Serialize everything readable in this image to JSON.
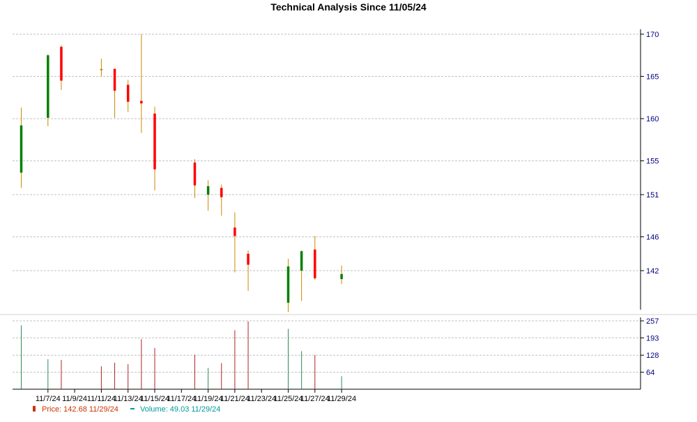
{
  "chart_data": {
    "type": "candlestick",
    "title": "Technical Analysis Since 11/05/24",
    "colors": {
      "up": "#008000",
      "down": "#ff0000",
      "doji": "#cc8800",
      "wick": "#cc8800",
      "volume_up": "#2e8b57",
      "volume_down": "#b22222",
      "price_axis_text": "#000080",
      "date_axis_text": "#000000",
      "grid": "#c0c0c0",
      "legend_price": "#cc3300",
      "legend_volume": "#009999"
    },
    "price_axis": {
      "side": "right",
      "ticks": [
        142,
        146,
        151,
        155,
        160,
        165,
        170
      ],
      "ylim": [
        136.5,
        170.1
      ]
    },
    "volume_axis": {
      "side": "right",
      "ticks": [
        64,
        128,
        193,
        257
      ],
      "ylim": [
        0,
        257
      ]
    },
    "x_ticks": [
      "11/7/24",
      "11/9/24",
      "11/11/24",
      "11/13/24",
      "11/15/24",
      "11/17/24",
      "11/19/24",
      "11/21/24",
      "11/23/24",
      "11/25/24",
      "11/27/24",
      "11/29/24"
    ],
    "grid": true,
    "candles": [
      {
        "date": "11/5/24",
        "open": 153.6,
        "high": 161.3,
        "low": 151.8,
        "close": 159.2,
        "volume": 240
      },
      {
        "date": "11/7/24",
        "open": 160.1,
        "high": 167.6,
        "low": 159.1,
        "close": 167.5,
        "volume": 113
      },
      {
        "date": "11/8/24",
        "open": 168.5,
        "high": 168.7,
        "low": 163.4,
        "close": 164.5,
        "volume": 110
      },
      {
        "date": "11/11/24",
        "open": 165.8,
        "high": 167.1,
        "low": 165.0,
        "close": 165.8,
        "volume": 86
      },
      {
        "date": "11/12/24",
        "open": 165.9,
        "high": 165.9,
        "low": 160.1,
        "close": 163.3,
        "volume": 100
      },
      {
        "date": "11/13/24",
        "open": 164.0,
        "high": 164.6,
        "low": 160.8,
        "close": 162.0,
        "volume": 94
      },
      {
        "date": "11/14/24",
        "open": 162.1,
        "high": 170.0,
        "low": 158.3,
        "close": 161.8,
        "volume": 188
      },
      {
        "date": "11/15/24",
        "open": 160.6,
        "high": 161.4,
        "low": 151.5,
        "close": 154.0,
        "volume": 155
      },
      {
        "date": "11/18/24",
        "open": 154.8,
        "high": 155.2,
        "low": 150.6,
        "close": 152.1,
        "volume": 130
      },
      {
        "date": "11/19/24",
        "open": 151.0,
        "high": 152.7,
        "low": 149.1,
        "close": 152.0,
        "volume": 80
      },
      {
        "date": "11/20/24",
        "open": 151.8,
        "high": 152.2,
        "low": 148.5,
        "close": 150.7,
        "volume": 98
      },
      {
        "date": "11/21/24",
        "open": 147.1,
        "high": 148.9,
        "low": 141.8,
        "close": 146.1,
        "volume": 222
      },
      {
        "date": "11/22/24",
        "open": 144.0,
        "high": 144.4,
        "low": 139.6,
        "close": 142.7,
        "volume": 255
      },
      {
        "date": "11/25/24",
        "open": 138.2,
        "high": 143.4,
        "low": 137.1,
        "close": 142.5,
        "volume": 227
      },
      {
        "date": "11/26/24",
        "open": 142.0,
        "high": 144.4,
        "low": 138.4,
        "close": 144.3,
        "volume": 143
      },
      {
        "date": "11/27/24",
        "open": 144.5,
        "high": 146.1,
        "low": 140.9,
        "close": 141.1,
        "volume": 128
      },
      {
        "date": "11/29/24",
        "open": 141.0,
        "high": 142.6,
        "low": 140.4,
        "close": 141.6,
        "volume": 49
      }
    ],
    "legend": {
      "price_label": "Price: 142.68",
      "price_date": "11/29/24",
      "volume_label": "Volume: 49.03",
      "volume_date": "11/29/24"
    }
  }
}
